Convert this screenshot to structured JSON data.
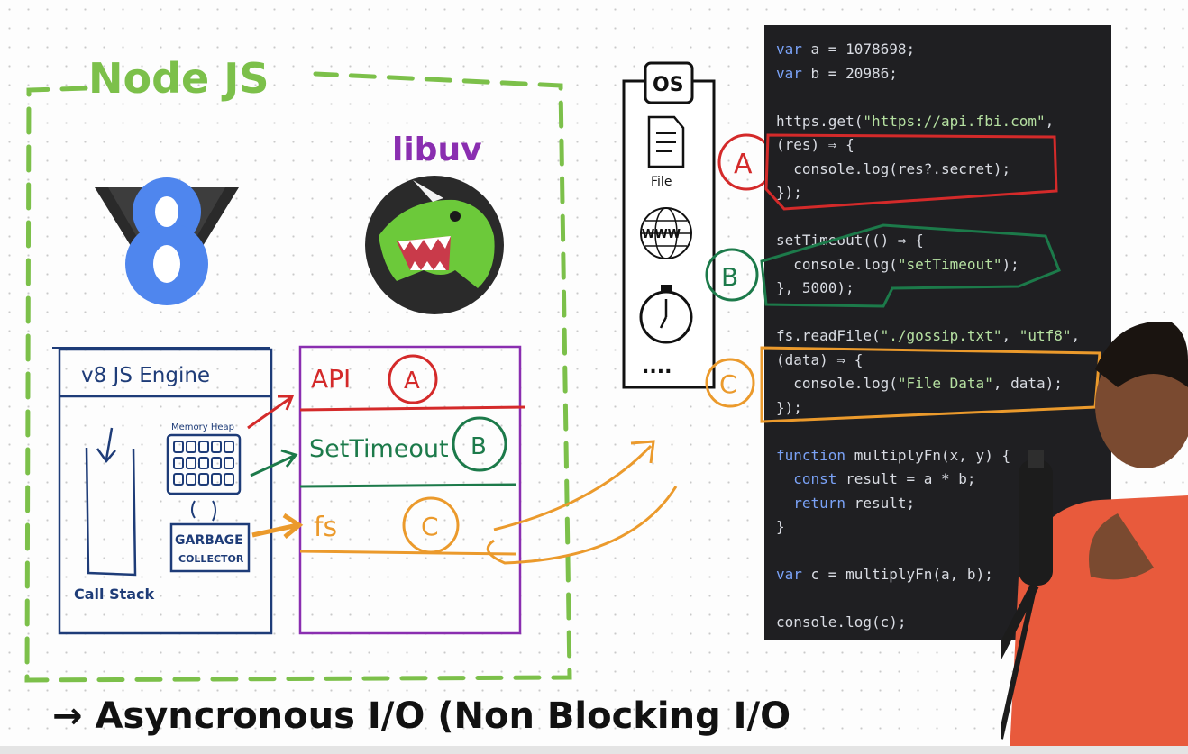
{
  "board": {
    "nodejs_title": "Node JS",
    "libuv_label": "libuv",
    "v8_box_title": "v8 JS Engine",
    "memory_heap_label": "Memory Heap",
    "garbage_collector_label_1": "GARBAGE",
    "garbage_collector_label_2": "COLLECTOR",
    "call_stack_label": "Call Stack",
    "libuv_rows": [
      {
        "label": "API",
        "tag": "A"
      },
      {
        "label": "SetTimeout",
        "tag": "B"
      },
      {
        "label": "fs",
        "tag": "C"
      }
    ],
    "os_label": "OS",
    "file_label": "File",
    "www_label": "WWW",
    "more_label": "....",
    "callout_tags": [
      "A",
      "B",
      "C"
    ],
    "bottom_caption": "→ Asyncronous I/O (Non Blocking I/O"
  },
  "colors": {
    "green_dash": "#7cc04a",
    "purple_box": "#8a2eb0",
    "navy_box": "#1e3c78",
    "red": "#d42a2a",
    "teal": "#1c7a4a",
    "orange": "#eb9a2c",
    "code_bg": "#1f1f22"
  },
  "code": {
    "lines": [
      [
        {
          "t": "var",
          "c": "kw"
        },
        {
          "t": " a = 1078698;"
        }
      ],
      [
        {
          "t": "var",
          "c": "kw"
        },
        {
          "t": " b = 20986;"
        }
      ],
      [
        {
          "t": ""
        }
      ],
      [
        {
          "t": "https.get("
        },
        {
          "t": "\"https://api.fbi.com\"",
          "c": "str"
        },
        {
          "t": ","
        }
      ],
      [
        {
          "t": "(res) ⇒ {"
        }
      ],
      [
        {
          "t": "  console.log(res?.secret);"
        }
      ],
      [
        {
          "t": "});"
        }
      ],
      [
        {
          "t": ""
        }
      ],
      [
        {
          "t": "setTimeout(() ⇒ {"
        }
      ],
      [
        {
          "t": "  console.log("
        },
        {
          "t": "\"setTimeout\"",
          "c": "str"
        },
        {
          "t": ");"
        }
      ],
      [
        {
          "t": "}, 5000);"
        }
      ],
      [
        {
          "t": ""
        }
      ],
      [
        {
          "t": "fs.readFile("
        },
        {
          "t": "\"./gossip.txt\"",
          "c": "str"
        },
        {
          "t": ", "
        },
        {
          "t": "\"utf8\"",
          "c": "str"
        },
        {
          "t": ","
        }
      ],
      [
        {
          "t": "(data) ⇒ {"
        }
      ],
      [
        {
          "t": "  console.log("
        },
        {
          "t": "\"File Data\"",
          "c": "str"
        },
        {
          "t": ", data);"
        }
      ],
      [
        {
          "t": "});"
        }
      ],
      [
        {
          "t": ""
        }
      ],
      [
        {
          "t": "function",
          "c": "kw"
        },
        {
          "t": " multiplyFn(x, y) {"
        }
      ],
      [
        {
          "t": "  "
        },
        {
          "t": "const",
          "c": "kw"
        },
        {
          "t": " result = a * b;"
        }
      ],
      [
        {
          "t": "  "
        },
        {
          "t": "return",
          "c": "kw"
        },
        {
          "t": " result;"
        }
      ],
      [
        {
          "t": "}"
        }
      ],
      [
        {
          "t": ""
        }
      ],
      [
        {
          "t": "var",
          "c": "kw"
        },
        {
          "t": " c = multiplyFn(a, b);"
        }
      ],
      [
        {
          "t": ""
        }
      ],
      [
        {
          "t": "console.log(c);"
        }
      ]
    ]
  }
}
